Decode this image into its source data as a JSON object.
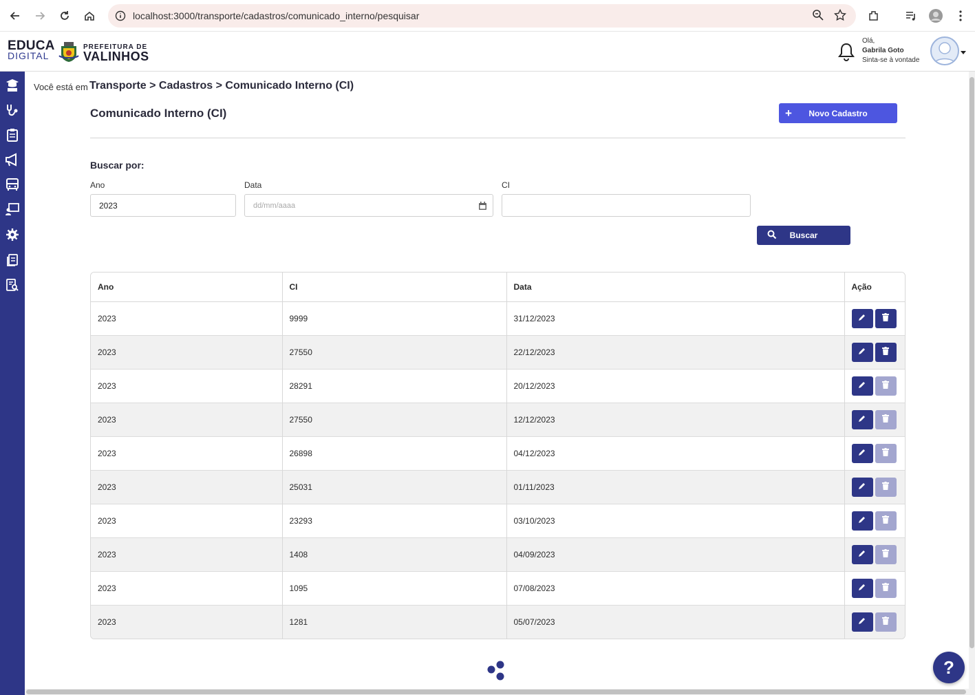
{
  "browser": {
    "url": "localhost:3000/transporte/cadastros/comunicado_interno/pesquisar"
  },
  "header": {
    "logo_educa_line1": "EDUCA",
    "logo_educa_line2": "DIGITAL",
    "logo_pref_line1": "PREFEITURA DE",
    "logo_pref_line2": "VALINHOS",
    "greeting": "Olá,",
    "user_name": "Gabrila Goto",
    "user_tagline": "Sinta-se à vontade"
  },
  "sidebar": {
    "icons": [
      "graduation-icon",
      "stethoscope-icon",
      "clipboard-icon",
      "megaphone-icon",
      "bus-icon",
      "teacher-icon",
      "gear-icon",
      "documents-icon",
      "report-search-icon"
    ]
  },
  "breadcrumb": {
    "prefix": "Você está em",
    "path": "Transporte > Cadastros > Comunicado Interno (CI)"
  },
  "page": {
    "title": "Comunicado Interno (CI)",
    "new_button": "Novo Cadastro"
  },
  "search": {
    "heading": "Buscar por:",
    "ano_label": "Ano",
    "ano_value": "2023",
    "data_label": "Data",
    "data_placeholder": "dd/mm/aaaa",
    "ci_label": "CI",
    "ci_value": "",
    "button": "Buscar"
  },
  "table": {
    "headers": [
      "Ano",
      "CI",
      "Data",
      "Ação"
    ],
    "rows": [
      {
        "ano": "2023",
        "ci": "9999",
        "data": "31/12/2023",
        "delete_enabled": true
      },
      {
        "ano": "2023",
        "ci": "27550",
        "data": "22/12/2023",
        "delete_enabled": true
      },
      {
        "ano": "2023",
        "ci": "28291",
        "data": "20/12/2023",
        "delete_enabled": false
      },
      {
        "ano": "2023",
        "ci": "27550",
        "data": "12/12/2023",
        "delete_enabled": false
      },
      {
        "ano": "2023",
        "ci": "26898",
        "data": "04/12/2023",
        "delete_enabled": false
      },
      {
        "ano": "2023",
        "ci": "25031",
        "data": "01/11/2023",
        "delete_enabled": false
      },
      {
        "ano": "2023",
        "ci": "23293",
        "data": "03/10/2023",
        "delete_enabled": false
      },
      {
        "ano": "2023",
        "ci": "1408",
        "data": "04/09/2023",
        "delete_enabled": false
      },
      {
        "ano": "2023",
        "ci": "1095",
        "data": "07/08/2023",
        "delete_enabled": false
      },
      {
        "ano": "2023",
        "ci": "1281",
        "data": "05/07/2023",
        "delete_enabled": false
      }
    ]
  },
  "help_button": "?",
  "colors": {
    "primary": "#2e3687",
    "accent": "#4d56e0",
    "disabled": "#a3a6cf"
  }
}
